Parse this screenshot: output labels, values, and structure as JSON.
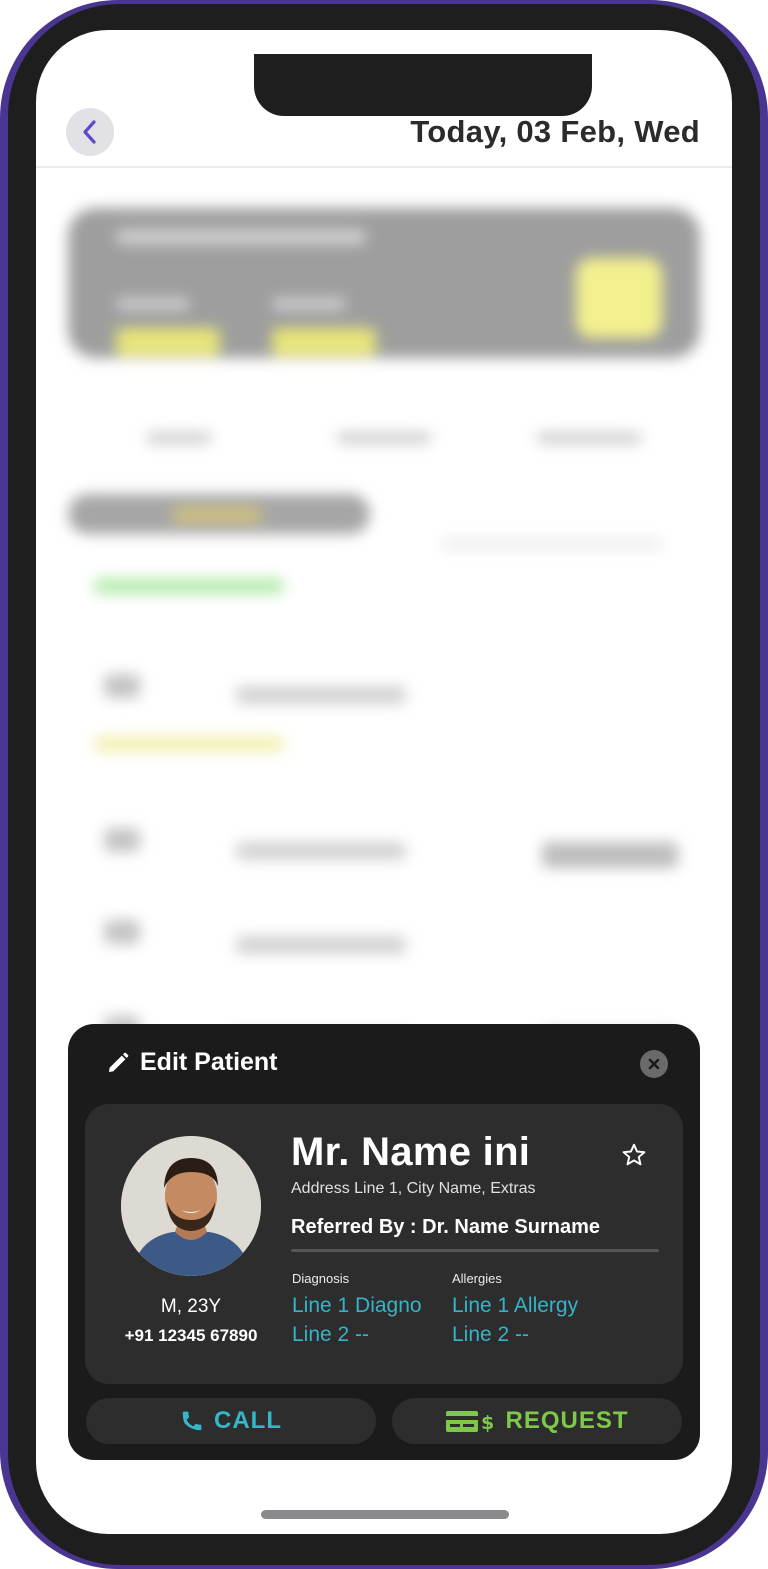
{
  "header": {
    "date": "Today, 03 Feb, Wed"
  },
  "modal": {
    "title": "Edit Patient",
    "patient": {
      "name": "Mr. Name ini",
      "address": "Address Line 1, City Name, Extras",
      "referred_by": "Referred By : Dr. Name Surname",
      "gender_age": "M, 23Y",
      "phone": "+91 12345 67890",
      "diagnosis_label": "Diagnosis",
      "diagnosis_line1": "Line 1 Diagno",
      "diagnosis_line2": "Line 2 --",
      "allergies_label": "Allergies",
      "allergies_line1": "Line 1 Allergy",
      "allergies_line2": "Line 2 --"
    },
    "actions": {
      "call_label": "CALL",
      "request_label": "REQUEST"
    }
  },
  "colors": {
    "accent_cyan": "#35b3c9",
    "accent_green": "#7ec84a",
    "modal_bg": "#1b1b1b",
    "card_bg": "#2d2d2d",
    "frame_purple": "#4a3590"
  }
}
